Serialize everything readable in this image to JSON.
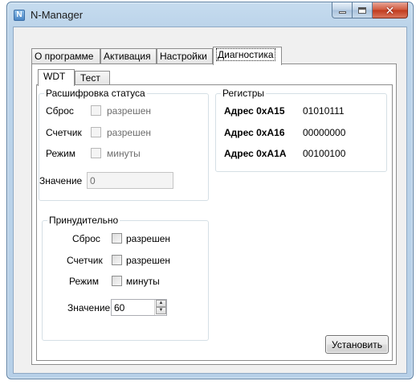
{
  "window": {
    "title": "N-Manager",
    "app_icon_letter": "N"
  },
  "tabs": [
    "О программе",
    "Активация",
    "Настройки",
    "Диагностика"
  ],
  "inner_tabs": [
    "WDT",
    "Тест"
  ],
  "status_decode": {
    "title": "Расшифровка статуса",
    "rows": [
      {
        "label": "Сброс",
        "checkbox_label": "разрешен"
      },
      {
        "label": "Счетчик",
        "checkbox_label": "разрешен"
      },
      {
        "label": "Режим",
        "checkbox_label": "минуты"
      }
    ],
    "value_label": "Значение",
    "value": "0"
  },
  "registers": {
    "title": "Регистры",
    "rows": [
      {
        "address": "Адрес 0xA15",
        "value": "01010111"
      },
      {
        "address": "Адрес 0xA16",
        "value": "00000000"
      },
      {
        "address": "Адрес 0xA1A",
        "value": "00100100"
      }
    ]
  },
  "forced": {
    "title": "Принудительно",
    "rows": [
      {
        "label": "Сброс",
        "checkbox_label": "разрешен"
      },
      {
        "label": "Счетчик",
        "checkbox_label": "разрешен"
      },
      {
        "label": "Режим",
        "checkbox_label": "минуты"
      }
    ],
    "value_label": "Значение",
    "value": "60"
  },
  "set_button": "Установить"
}
